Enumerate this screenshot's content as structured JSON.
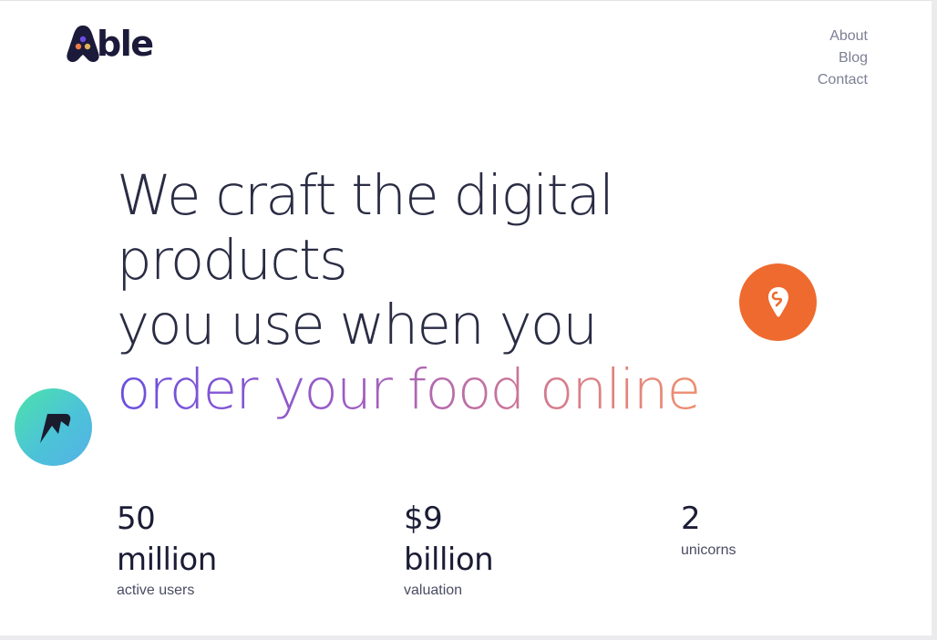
{
  "brand": {
    "name": "Able",
    "logo_text": "ble"
  },
  "nav": {
    "items": [
      "About",
      "Blog",
      "Contact"
    ]
  },
  "hero": {
    "line1": "We craft the digital",
    "line2": "products",
    "line3": "you use when you",
    "highlight": "order your food online"
  },
  "badges": [
    {
      "icon": "swiggy-logo-icon",
      "color": "#ef6a2e"
    },
    {
      "icon": "lightning-brand-icon",
      "color": "#4cc9c0"
    }
  ],
  "stats": [
    {
      "value": "50 million",
      "label": "active users"
    },
    {
      "value": "$9 billion",
      "label": "valuation"
    },
    {
      "value": "2",
      "label": "unicorns"
    }
  ],
  "colors": {
    "text": "#2a2c44",
    "gradient_start": "#6a4fe0",
    "gradient_end": "#ef8d6d",
    "nav": "#7d7f95"
  }
}
